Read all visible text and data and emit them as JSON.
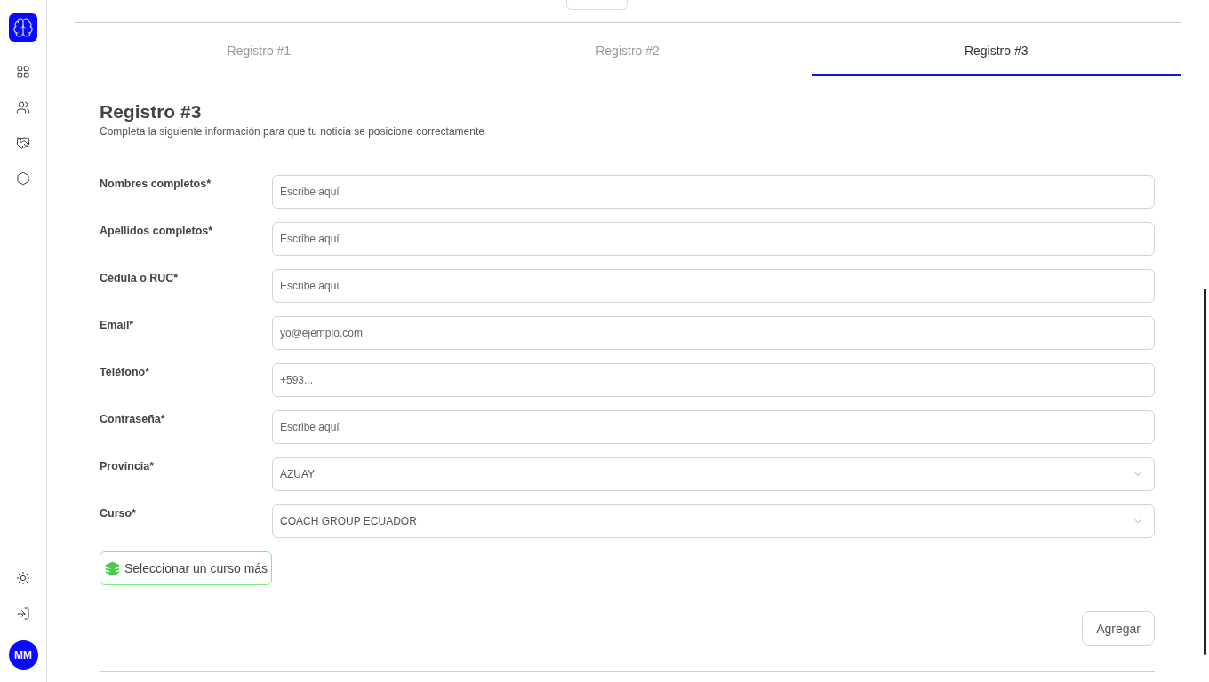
{
  "sidebar": {
    "nav_items": [
      {
        "kind": "dashboard"
      },
      {
        "kind": "users"
      },
      {
        "kind": "handshake"
      },
      {
        "kind": "settings"
      }
    ],
    "bottom_items": [
      {
        "kind": "theme"
      },
      {
        "kind": "logout"
      }
    ],
    "avatar": "MM"
  },
  "tabs": [
    {
      "label": "Registro #1",
      "selected": false
    },
    {
      "label": "Registro #2",
      "selected": false
    },
    {
      "label": "Registro #3",
      "selected": true
    }
  ],
  "form": {
    "title": "Registro #3",
    "subtitle": "Completa la siguiente información para que tu noticia se posicione correctamente",
    "fields": [
      {
        "kind": "input",
        "label": "Nombres completos*",
        "placeholder": "Escribe aquí"
      },
      {
        "kind": "input",
        "label": "Apellidos completos*",
        "placeholder": "Escribe aquí"
      },
      {
        "kind": "input",
        "label": "Cédula o RUC*",
        "placeholder": "Escribe aquí"
      },
      {
        "kind": "input",
        "label": "Email*",
        "placeholder": "yo@ejemplo.com"
      },
      {
        "kind": "input",
        "label": "Teléfono*",
        "placeholder": "+593..."
      },
      {
        "kind": "input",
        "label": "Contraseña*",
        "placeholder": "Escribe aquí"
      },
      {
        "kind": "select",
        "label": "Provincia*",
        "value": "AZUAY"
      },
      {
        "kind": "select",
        "label": "Curso*",
        "value": "COACH GROUP ECUADOR"
      }
    ],
    "add_course_button": "Seleccionar un curso más",
    "submit_button": "Agregar"
  }
}
